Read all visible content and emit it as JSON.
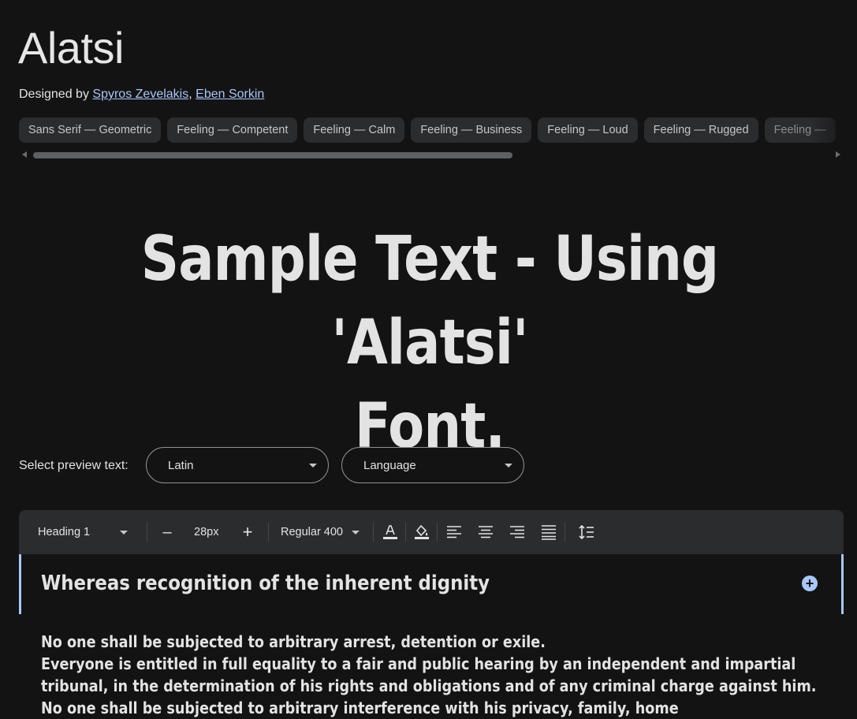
{
  "title": "Alatsi",
  "designers": {
    "prefix": "Designed by",
    "names": [
      "Spyros Zevelakis",
      "Eben Sorkin"
    ],
    "separator": ","
  },
  "tags": [
    "Sans Serif — Geometric",
    "Feeling — Competent",
    "Feeling — Calm",
    "Feeling — Business",
    "Feeling — Loud",
    "Feeling — Rugged",
    "Feeling —"
  ],
  "sample": {
    "line1": "Sample Text - Using 'Alatsi'",
    "line2": "Font."
  },
  "preview": {
    "label": "Select preview text:",
    "script_value": "Latin",
    "language_value": "Language"
  },
  "toolbar": {
    "style": "Heading 1",
    "size": "28px",
    "weight": "Regular 400",
    "decrease_label": "–",
    "increase_label": "+"
  },
  "editor": {
    "heading": "Whereas recognition of the inherent dignity",
    "paragraphs": [
      "No one shall be subjected to arbitrary arrest, detention or exile.",
      "Everyone is entitled in full equality to a fair and public hearing by an independent and impartial",
      "tribunal, in the determination of his rights and obligations and of any criminal charge against him.",
      "No one shall be subjected to arbitrary interference with his privacy, family, home"
    ]
  },
  "colors": {
    "background": "#131313",
    "surface": "#2b2c2e",
    "accent": "#a8c7fa",
    "text": "#e3e3e3"
  }
}
